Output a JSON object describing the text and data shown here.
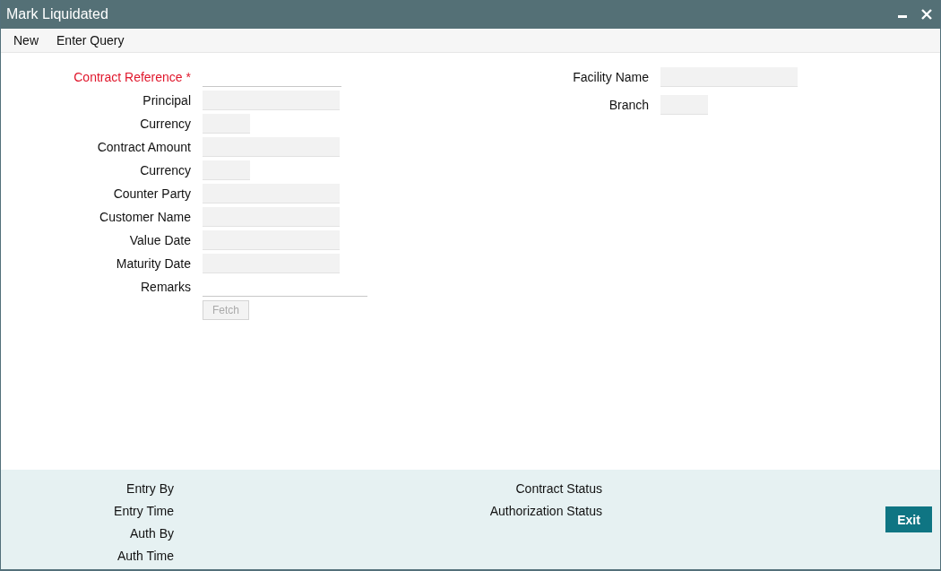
{
  "window": {
    "title": "Mark Liquidated"
  },
  "toolbar": [
    "New",
    "Enter Query"
  ],
  "left_fields": [
    {
      "label": "Contract Reference",
      "required": true,
      "required_mark": "*",
      "kind": "line"
    },
    {
      "label": "Principal",
      "required": false,
      "kind": "box"
    },
    {
      "label": "Currency",
      "required": false,
      "kind": "short"
    },
    {
      "label": "Contract Amount",
      "required": false,
      "kind": "box"
    },
    {
      "label": "Currency",
      "required": false,
      "kind": "short"
    },
    {
      "label": "Counter Party",
      "required": false,
      "kind": "box"
    },
    {
      "label": "Customer Name",
      "required": false,
      "kind": "box"
    },
    {
      "label": "Value Date",
      "required": false,
      "kind": "box"
    },
    {
      "label": "Maturity Date",
      "required": false,
      "kind": "box"
    },
    {
      "label": "Remarks",
      "required": false,
      "kind": "wide-line"
    }
  ],
  "fetch_button": {
    "label": "Fetch",
    "disabled": true
  },
  "right_fields": [
    {
      "label": "Facility Name",
      "required": false,
      "kind": "box"
    },
    {
      "label": "Branch",
      "required": false,
      "kind": "short"
    }
  ],
  "footer": {
    "left": [
      "Entry By",
      "Entry Time",
      "Auth By",
      "Auth Time"
    ],
    "middle": [
      "Contract Status",
      "Authorization Status"
    ],
    "exit_button": "Exit"
  }
}
